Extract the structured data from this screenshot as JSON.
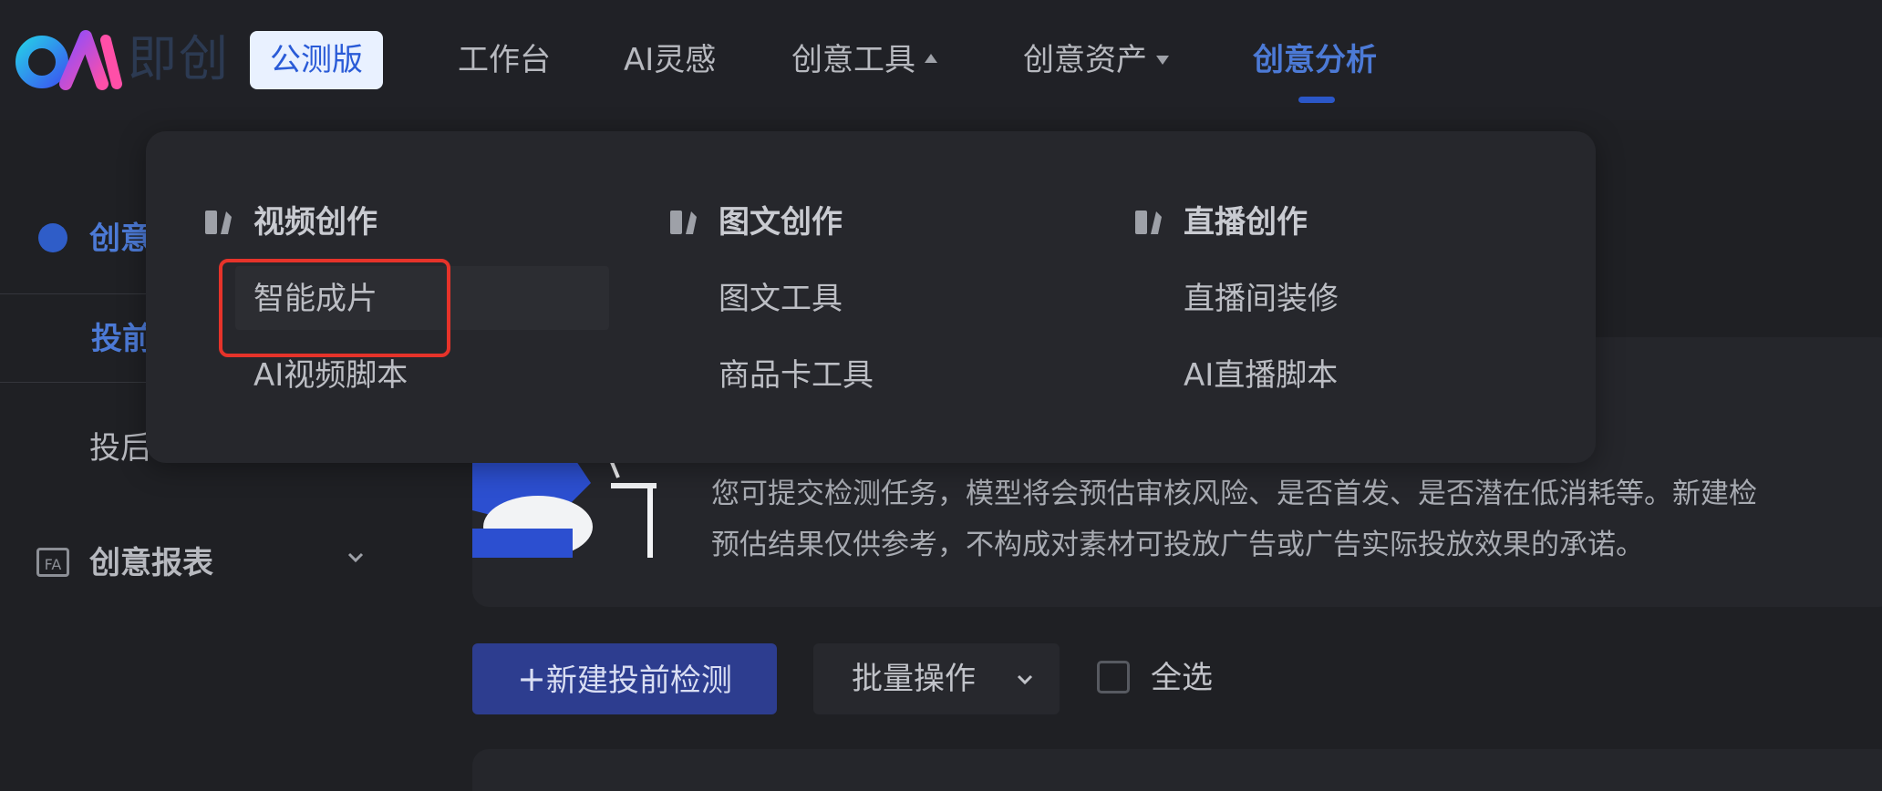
{
  "header": {
    "brand": "即创",
    "badge": "公测版",
    "nav": [
      {
        "label": "工作台"
      },
      {
        "label": "AI灵感"
      },
      {
        "label": "创意工具"
      },
      {
        "label": "创意资产"
      },
      {
        "label": "创意分析"
      }
    ]
  },
  "sidebar": {
    "section_label": "创意",
    "sub_active": "投前",
    "sub_item": "投后",
    "report_icon_text": "FA",
    "report_label": "创意报表"
  },
  "main": {
    "info_line1": "您可提交检测任务，模型将会预估审核风险、是否首发、是否潜在低消耗等。新建检",
    "info_line2": "预估结果仅供参考，不构成对素材可投放广告或广告实际投放效果的承诺。",
    "new_button": "新建投前检测",
    "new_button_plus": "+",
    "batch_button": "批量操作",
    "select_all": "全选"
  },
  "dropdown": {
    "columns": [
      {
        "title": "视频创作",
        "items": [
          "智能成片",
          "AI视频脚本"
        ]
      },
      {
        "title": "图文创作",
        "items": [
          "图文工具",
          "商品卡工具"
        ]
      },
      {
        "title": "直播创作",
        "items": [
          "直播间装修",
          "AI直播脚本"
        ]
      }
    ]
  },
  "colors": {
    "accent": "#4c7ad6",
    "highlight": "#e6332a",
    "badge_bg": "#e9f1ff",
    "background": "#1f2024"
  }
}
